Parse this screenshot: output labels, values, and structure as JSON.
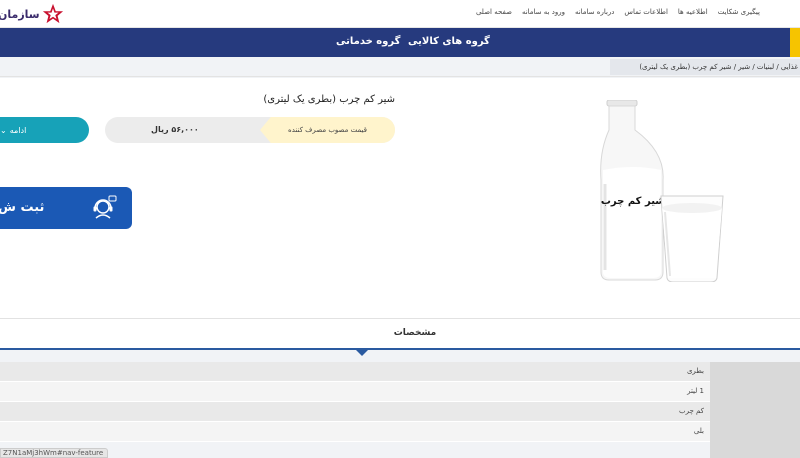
{
  "logo": {
    "text": "سازمان"
  },
  "top_links": [
    "صفحه اصلی",
    "ورود به سامانه",
    "درباره سامانه",
    "اطلاعات تماس",
    "اطلاعیه ها",
    "پیگیری شکایت"
  ],
  "nav": {
    "goods_group": "گروه های کالایی",
    "services_group": "گروه خدماتی"
  },
  "breadcrumb": "غذایی  /  لبنیات  /  شیر  /  شیر کم چرب (بطری یک لیتری)",
  "product": {
    "title": "شیر کم چرب (بطری یک لیتری)",
    "price_label": "قیمت مصوب مصرف کننده",
    "price_value": "۵۶,۰۰۰ ریال",
    "continue_label": "ادامه",
    "register_label": "ثبت ش",
    "bottle_label": "شیر کم چرب"
  },
  "specs": {
    "title": "مشخصات",
    "values": [
      "بطری",
      "1 لیتر",
      "کم چرب",
      "بلی"
    ]
  },
  "status_url": "Z7N1aMj3hWm#nav-feature",
  "colors": {
    "nav": "#263a7e",
    "accent": "#17a2b8",
    "register": "#1b59b5",
    "price_label_bg": "#fff4cc"
  }
}
